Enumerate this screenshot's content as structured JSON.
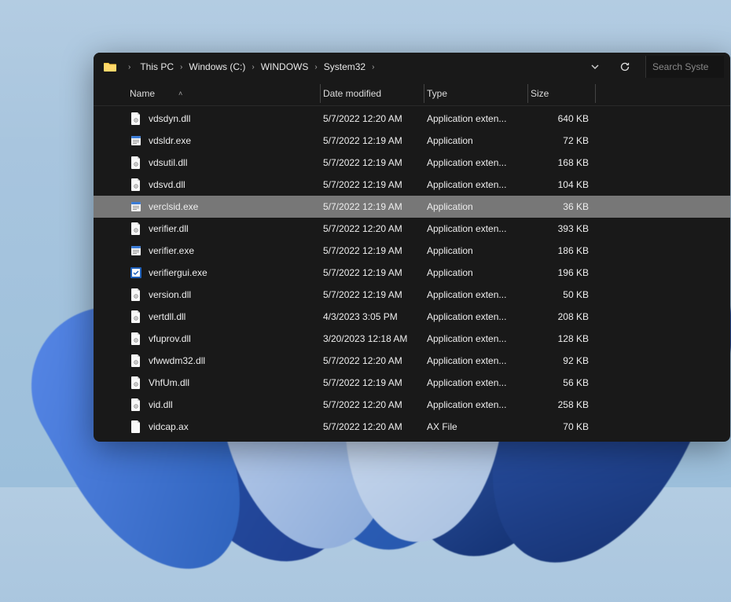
{
  "breadcrumbs": [
    "This PC",
    "Windows (C:)",
    "WINDOWS",
    "System32"
  ],
  "search_placeholder": "Search Syste",
  "columns": {
    "name": "Name",
    "date": "Date modified",
    "type": "Type",
    "size": "Size"
  },
  "files": [
    {
      "name": "vdsdyn.dll",
      "date": "5/7/2022 12:20 AM",
      "type": "Application exten...",
      "size": "640 KB",
      "icon": "dll",
      "selected": false
    },
    {
      "name": "vdsldr.exe",
      "date": "5/7/2022 12:19 AM",
      "type": "Application",
      "size": "72 KB",
      "icon": "exe",
      "selected": false
    },
    {
      "name": "vdsutil.dll",
      "date": "5/7/2022 12:19 AM",
      "type": "Application exten...",
      "size": "168 KB",
      "icon": "dll",
      "selected": false
    },
    {
      "name": "vdsvd.dll",
      "date": "5/7/2022 12:19 AM",
      "type": "Application exten...",
      "size": "104 KB",
      "icon": "dll",
      "selected": false
    },
    {
      "name": "verclsid.exe",
      "date": "5/7/2022 12:19 AM",
      "type": "Application",
      "size": "36 KB",
      "icon": "exe",
      "selected": true
    },
    {
      "name": "verifier.dll",
      "date": "5/7/2022 12:20 AM",
      "type": "Application exten...",
      "size": "393 KB",
      "icon": "dll",
      "selected": false
    },
    {
      "name": "verifier.exe",
      "date": "5/7/2022 12:19 AM",
      "type": "Application",
      "size": "186 KB",
      "icon": "exe",
      "selected": false
    },
    {
      "name": "verifiergui.exe",
      "date": "5/7/2022 12:19 AM",
      "type": "Application",
      "size": "196 KB",
      "icon": "exe-gui",
      "selected": false
    },
    {
      "name": "version.dll",
      "date": "5/7/2022 12:19 AM",
      "type": "Application exten...",
      "size": "50 KB",
      "icon": "dll",
      "selected": false
    },
    {
      "name": "vertdll.dll",
      "date": "4/3/2023 3:05 PM",
      "type": "Application exten...",
      "size": "208 KB",
      "icon": "dll",
      "selected": false
    },
    {
      "name": "vfuprov.dll",
      "date": "3/20/2023 12:18 AM",
      "type": "Application exten...",
      "size": "128 KB",
      "icon": "dll",
      "selected": false
    },
    {
      "name": "vfwwdm32.dll",
      "date": "5/7/2022 12:20 AM",
      "type": "Application exten...",
      "size": "92 KB",
      "icon": "dll",
      "selected": false
    },
    {
      "name": "VhfUm.dll",
      "date": "5/7/2022 12:19 AM",
      "type": "Application exten...",
      "size": "56 KB",
      "icon": "dll",
      "selected": false
    },
    {
      "name": "vid.dll",
      "date": "5/7/2022 12:20 AM",
      "type": "Application exten...",
      "size": "258 KB",
      "icon": "dll",
      "selected": false
    },
    {
      "name": "vidcap.ax",
      "date": "5/7/2022 12:20 AM",
      "type": "AX File",
      "size": "70 KB",
      "icon": "file",
      "selected": false
    }
  ]
}
